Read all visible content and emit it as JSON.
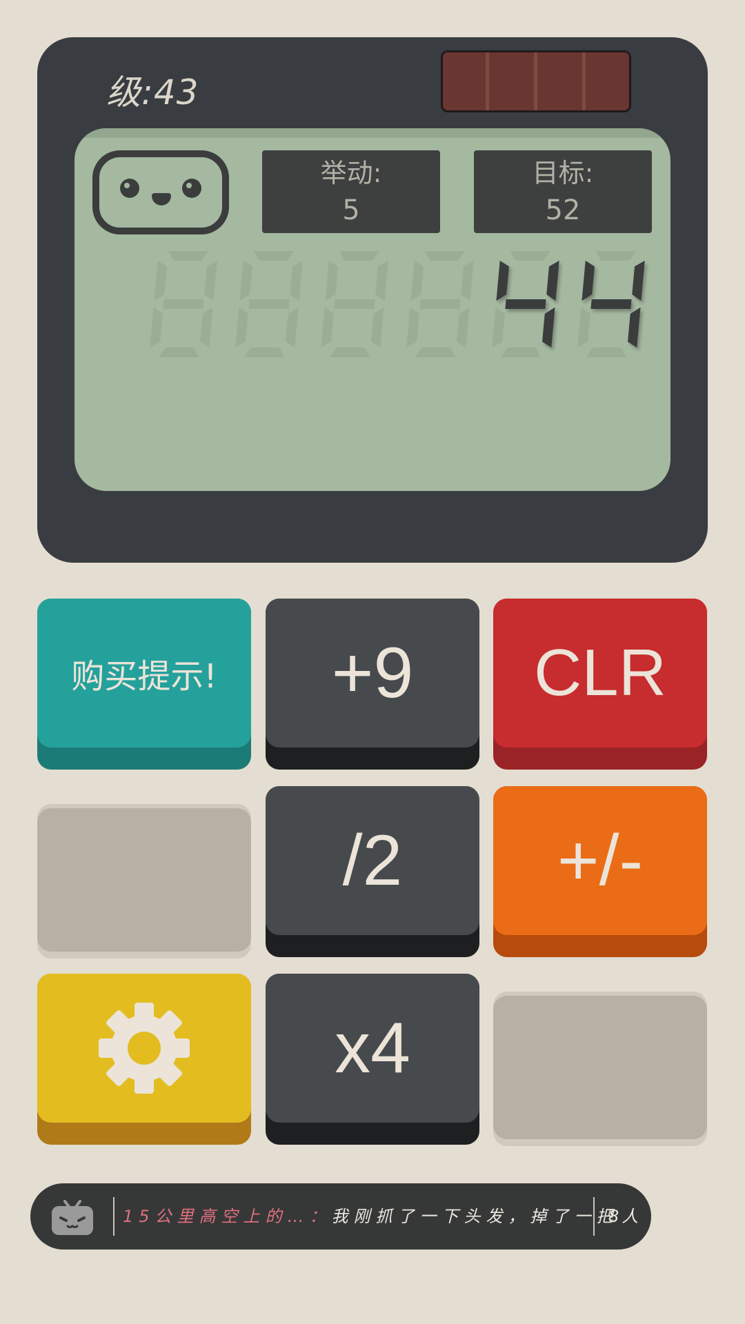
{
  "level": {
    "label": "级:",
    "value": "43"
  },
  "moves": {
    "label": "举动:",
    "value": "5"
  },
  "goal": {
    "label": "目标:",
    "value": "52"
  },
  "display": {
    "value": "44"
  },
  "buttons": {
    "hint": "购买提示!",
    "plus9": "+9",
    "clear": "CLR",
    "div2": "/2",
    "negate": "+/-",
    "times4": "x4",
    "settings_icon": "gear-icon"
  },
  "danmaku": {
    "title": "15公里高空上的…：",
    "comment": "我刚抓了一下头发，掉了一把",
    "viewers": "8人",
    "icon": "bilibili-tv-icon"
  },
  "colors": {
    "hint": "#25a19c",
    "operation": "#464a4d",
    "clear": "#c72c2e",
    "negate": "#ea6c16",
    "settings": "#e3bc20",
    "screen": "#a5b8a0"
  }
}
